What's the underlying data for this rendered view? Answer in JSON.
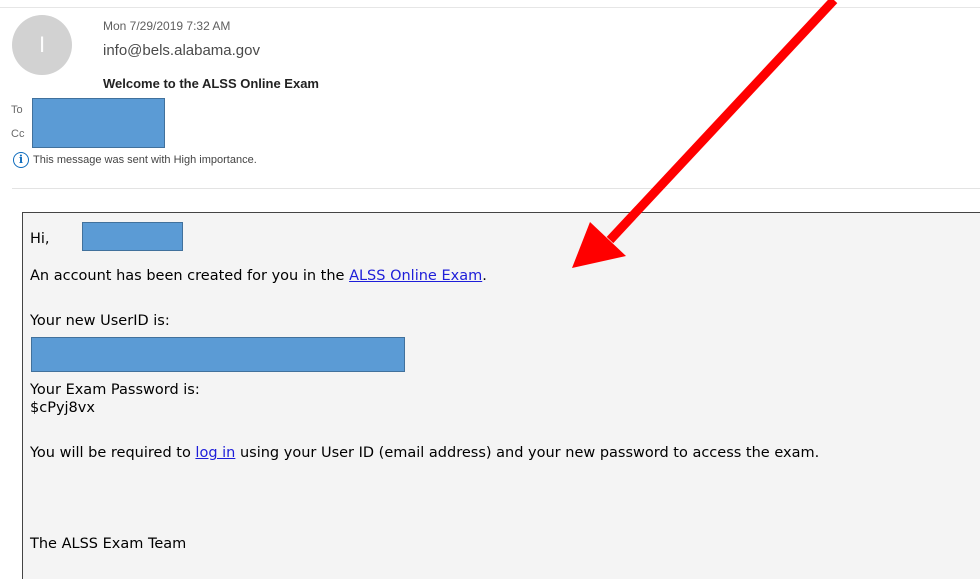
{
  "email": {
    "avatar_initial": "I",
    "sent_date": "Mon 7/29/2019 7:32 AM",
    "sender": "info@bels.alabama.gov",
    "subject": "Welcome to the ALSS Online Exam",
    "to_label": "To",
    "cc_label": "Cc",
    "importance_text": "This message was sent with High importance."
  },
  "body": {
    "greeting": "Hi,",
    "account_prefix": "An account has been created for you in the ",
    "account_link": "ALSS Online Exam",
    "account_suffix": ".",
    "userid_label": "Your new UserID is:",
    "password_label": "Your Exam Password is:",
    "password_value": "$cPyj8vx",
    "login_prefix": "You will be required to ",
    "login_link": "log in",
    "login_suffix": " using your User ID (email address) and your new password to access the exam.",
    "signature": "The ALSS Exam Team"
  },
  "colors": {
    "redaction": "#5b9bd5",
    "link": "#1d1dd9",
    "arrow": "#ff0000",
    "info_icon": "#0f6cbd"
  },
  "icons": {
    "info": "info-icon",
    "avatar": "sender-avatar"
  }
}
